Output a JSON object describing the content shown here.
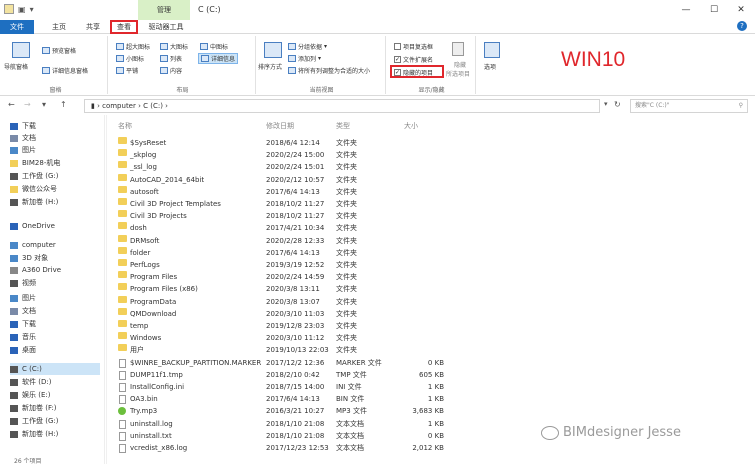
{
  "window": {
    "title": "C (C:)",
    "context_group": "管理",
    "controls": {
      "minimize": "—",
      "maximize": "☐",
      "close": "✕"
    }
  },
  "tabs": {
    "file": "文件",
    "home": "主页",
    "share": "共享",
    "view": "查看",
    "drive_tools": "驱动器工具"
  },
  "ribbon": {
    "pane": {
      "nav_pane": "导航窗格",
      "preview_pane": "预览窗格",
      "details_pane": "详细信息窗格",
      "group_name": "窗格"
    },
    "layout": {
      "xl_icons": "超大图标",
      "large_icons": "大图标",
      "medium_icons": "中图标",
      "small_icons": "小图标",
      "list": "列表",
      "details": "详细信息",
      "tiles": "平铺",
      "content": "内容",
      "group_name": "布局"
    },
    "current_view": {
      "sort_by": "排序方式",
      "group_by": "分组依据",
      "add_columns": "添加列",
      "fit_columns": "将所有列调整为合适的大小",
      "group_name": "当前视图"
    },
    "show_hide": {
      "item_checkboxes": "项目复选框",
      "file_extensions": "文件扩展名",
      "hidden_items": "隐藏的项目",
      "hide_selected_1": "隐藏",
      "hide_selected_2": "所选项目",
      "group_name": "显示/隐藏"
    },
    "options": "选项",
    "annotation": "WIN10"
  },
  "address": {
    "path_computer": "computer",
    "path_drive": "C (C:)",
    "search_placeholder": "搜索\"C (C:)\""
  },
  "nav": {
    "items": [
      {
        "label": "下载",
        "icon": "download-icon",
        "color": "#2a63b8"
      },
      {
        "label": "文档",
        "icon": "document-icon",
        "color": "#7a8aa8"
      },
      {
        "label": "图片",
        "icon": "pictures-icon",
        "color": "#4a88c8"
      },
      {
        "label": "BIM28-机电",
        "icon": "folder-icon",
        "color": "#f2cf59"
      },
      {
        "label": "工作盘 (G:)",
        "icon": "drive-icon",
        "color": "#555555"
      },
      {
        "label": "微信公众号",
        "icon": "folder-icon",
        "color": "#f2cf59"
      },
      {
        "label": "新加卷 (H:)",
        "icon": "drive-icon",
        "color": "#555555"
      },
      {
        "label": "OneDrive",
        "icon": "cloud-icon",
        "color": "#2a63b8"
      },
      {
        "label": "computer",
        "icon": "computer-icon",
        "color": "#4a88c8"
      },
      {
        "label": "3D 对象",
        "icon": "3d-objects-icon",
        "color": "#4a88c8"
      },
      {
        "label": "A360 Drive",
        "icon": "a360-icon",
        "color": "#888888"
      },
      {
        "label": "视频",
        "icon": "video-icon",
        "color": "#555555"
      },
      {
        "label": "图片",
        "icon": "pictures-icon",
        "color": "#4a88c8"
      },
      {
        "label": "文档",
        "icon": "document-icon",
        "color": "#7a8aa8"
      },
      {
        "label": "下载",
        "icon": "download-icon",
        "color": "#2a63b8"
      },
      {
        "label": "音乐",
        "icon": "music-icon",
        "color": "#2a63b8"
      },
      {
        "label": "桌面",
        "icon": "desktop-icon",
        "color": "#2a63b8"
      },
      {
        "label": "C (C:)",
        "icon": "drive-icon",
        "color": "#555555",
        "selected": true
      },
      {
        "label": "软件 (D:)",
        "icon": "drive-icon",
        "color": "#555555"
      },
      {
        "label": "娱乐 (E:)",
        "icon": "drive-icon",
        "color": "#555555"
      },
      {
        "label": "新加卷 (F:)",
        "icon": "drive-icon",
        "color": "#555555"
      },
      {
        "label": "工作盘 (G:)",
        "icon": "drive-icon",
        "color": "#555555"
      },
      {
        "label": "新加卷 (H:)",
        "icon": "drive-icon",
        "color": "#555555"
      }
    ]
  },
  "columns": {
    "name": "名称",
    "modified": "修改日期",
    "type": "类型",
    "size": "大小"
  },
  "files": [
    {
      "name": "$SysReset",
      "date": "2018/6/4 12:14",
      "type": "文件夹",
      "size": "",
      "kind": "folder"
    },
    {
      "name": "_skplog",
      "date": "2020/2/24 15:00",
      "type": "文件夹",
      "size": "",
      "kind": "folder"
    },
    {
      "name": "_ssl_log",
      "date": "2020/2/24 15:01",
      "type": "文件夹",
      "size": "",
      "kind": "folder"
    },
    {
      "name": "AutoCAD_2014_64bit",
      "date": "2020/2/12 10:57",
      "type": "文件夹",
      "size": "",
      "kind": "folder"
    },
    {
      "name": "autosoft",
      "date": "2017/6/4 14:13",
      "type": "文件夹",
      "size": "",
      "kind": "folder"
    },
    {
      "name": "Civil 3D Project Templates",
      "date": "2018/10/2 11:27",
      "type": "文件夹",
      "size": "",
      "kind": "folder"
    },
    {
      "name": "Civil 3D Projects",
      "date": "2018/10/2 11:27",
      "type": "文件夹",
      "size": "",
      "kind": "folder"
    },
    {
      "name": "dosh",
      "date": "2017/4/21 10:34",
      "type": "文件夹",
      "size": "",
      "kind": "folder"
    },
    {
      "name": "DRMsoft",
      "date": "2020/2/28 12:33",
      "type": "文件夹",
      "size": "",
      "kind": "folder"
    },
    {
      "name": "folder",
      "date": "2017/6/4 14:13",
      "type": "文件夹",
      "size": "",
      "kind": "folder"
    },
    {
      "name": "PerfLogs",
      "date": "2019/3/19 12:52",
      "type": "文件夹",
      "size": "",
      "kind": "folder"
    },
    {
      "name": "Program Files",
      "date": "2020/2/24 14:59",
      "type": "文件夹",
      "size": "",
      "kind": "folder"
    },
    {
      "name": "Program Files (x86)",
      "date": "2020/3/8 13:11",
      "type": "文件夹",
      "size": "",
      "kind": "folder"
    },
    {
      "name": "ProgramData",
      "date": "2020/3/8 13:07",
      "type": "文件夹",
      "size": "",
      "kind": "folder"
    },
    {
      "name": "QMDownload",
      "date": "2020/3/10 11:03",
      "type": "文件夹",
      "size": "",
      "kind": "folder"
    },
    {
      "name": "temp",
      "date": "2019/12/8 23:03",
      "type": "文件夹",
      "size": "",
      "kind": "folder"
    },
    {
      "name": "Windows",
      "date": "2020/3/10 11:12",
      "type": "文件夹",
      "size": "",
      "kind": "folder"
    },
    {
      "name": "用户",
      "date": "2019/10/13 22:03",
      "type": "文件夹",
      "size": "",
      "kind": "folder"
    },
    {
      "name": "$WINRE_BACKUP_PARTITION.MARKER",
      "date": "2017/12/2 12:36",
      "type": "MARKER 文件",
      "size": "0 KB",
      "kind": "file"
    },
    {
      "name": "DUMP11f1.tmp",
      "date": "2018/2/10 0:42",
      "type": "TMP 文件",
      "size": "605 KB",
      "kind": "file"
    },
    {
      "name": "InstallConfig.ini",
      "date": "2018/7/15 14:00",
      "type": "INI 文件",
      "size": "1 KB",
      "kind": "file"
    },
    {
      "name": "OA3.bin",
      "date": "2017/6/4 14:13",
      "type": "BIN 文件",
      "size": "1 KB",
      "kind": "file"
    },
    {
      "name": "Try.mp3",
      "date": "2016/3/21 10:27",
      "type": "MP3 文件",
      "size": "3,683 KB",
      "kind": "mp3"
    },
    {
      "name": "uninstall.log",
      "date": "2018/1/10 21:08",
      "type": "文本文档",
      "size": "1 KB",
      "kind": "file"
    },
    {
      "name": "uninstall.txt",
      "date": "2018/1/10 21:08",
      "type": "文本文档",
      "size": "0 KB",
      "kind": "file"
    },
    {
      "name": "vcredist_x86.log",
      "date": "2017/12/23 12:53",
      "type": "文本文档",
      "size": "2,012 KB",
      "kind": "file"
    }
  ],
  "watermark": "BIMdesigner Jesse",
  "status": "26 个项目"
}
